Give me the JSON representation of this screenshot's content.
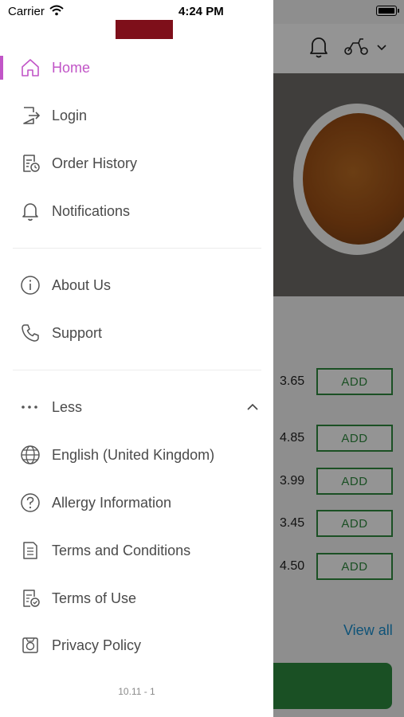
{
  "status_bar": {
    "carrier": "Carrier",
    "time": "4:24 PM"
  },
  "background": {
    "prices": [
      "3.65",
      "4.85",
      "3.99",
      "3.45",
      "4.50"
    ],
    "add_label": "ADD",
    "view_all": "View all"
  },
  "menu": {
    "primary": [
      {
        "label": "Home",
        "icon": "home-icon",
        "active": true
      },
      {
        "label": "Login",
        "icon": "login-icon"
      },
      {
        "label": "Order History",
        "icon": "order-history-icon"
      },
      {
        "label": "Notifications",
        "icon": "bell-icon"
      }
    ],
    "secondary": [
      {
        "label": "About Us",
        "icon": "info-icon"
      },
      {
        "label": "Support",
        "icon": "phone-icon"
      }
    ],
    "less_label": "Less",
    "more": [
      {
        "label": "English (United Kingdom)",
        "icon": "globe-icon"
      },
      {
        "label": "Allergy Information",
        "icon": "question-icon"
      },
      {
        "label": "Terms and Conditions",
        "icon": "document-icon"
      },
      {
        "label": "Terms of Use",
        "icon": "document-check-icon"
      },
      {
        "label": "Privacy Policy",
        "icon": "privacy-icon"
      }
    ]
  },
  "version": "10.11 - 1",
  "colors": {
    "accent": "#c155c7",
    "brand": "#7e0f1a",
    "add_green": "#2f8a3f",
    "link_blue": "#1a8fcf"
  }
}
